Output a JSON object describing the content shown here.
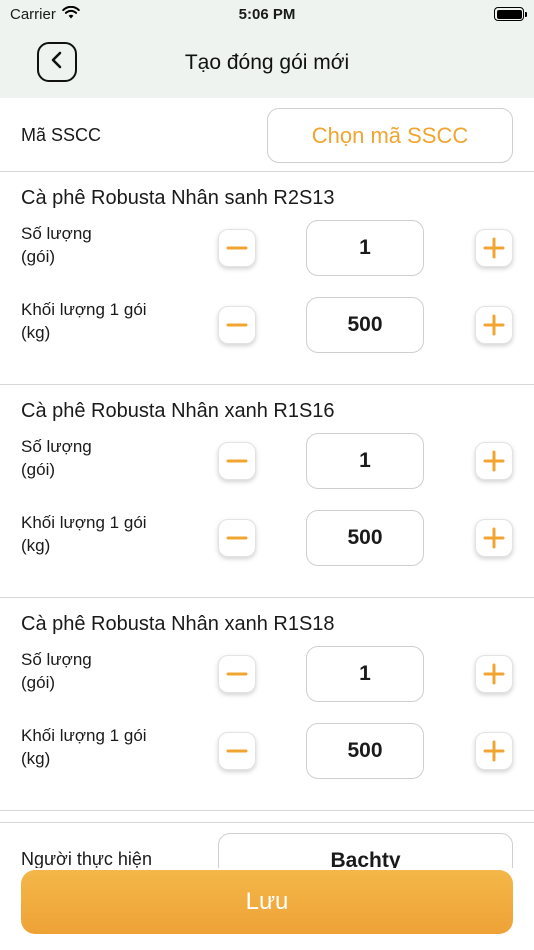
{
  "status_bar": {
    "carrier": "Carrier",
    "time": "5:06 PM"
  },
  "nav": {
    "title": "Tạo đóng gói mới",
    "back_icon": "chevron-left-icon"
  },
  "sscc": {
    "label": "Mã SSCC",
    "button_label": "Chọn mã SSCC"
  },
  "products": [
    {
      "title": "Cà phê Robusta Nhân sanh R2S13",
      "quantity_label_line1": "Số lượng",
      "quantity_label_line2": "(gói)",
      "quantity_value": "1",
      "weight_label_line1": "Khối lượng 1 gói",
      "weight_label_line2": "(kg)",
      "weight_value": "500"
    },
    {
      "title": "Cà phê Robusta Nhân xanh R1S16",
      "quantity_label_line1": "Số lượng",
      "quantity_label_line2": "(gói)",
      "quantity_value": "1",
      "weight_label_line1": "Khối lượng 1 gói",
      "weight_label_line2": "(kg)",
      "weight_value": "500"
    },
    {
      "title": "Cà phê Robusta Nhân xanh R1S18",
      "quantity_label_line1": "Số lượng",
      "quantity_label_line2": "(gói)",
      "quantity_value": "1",
      "weight_label_line1": "Khối lượng 1 gói",
      "weight_label_line2": "(kg)",
      "weight_value": "500"
    }
  ],
  "performer": {
    "label": "Người thực hiện",
    "value": "Bachty"
  },
  "save_button": {
    "label": "Lưu"
  },
  "colors": {
    "accent": "#f0a531",
    "header_bg": "#eef3ef"
  }
}
